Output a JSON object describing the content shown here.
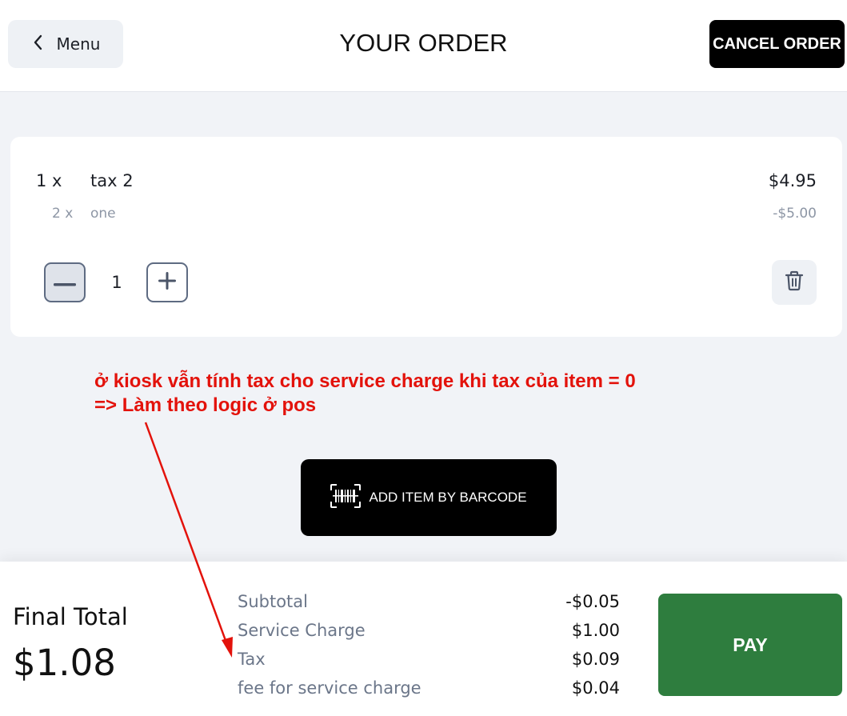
{
  "header": {
    "back_label": "Menu",
    "title": "YOUR ORDER",
    "cancel_label": "CANCEL ORDER"
  },
  "order": {
    "items": [
      {
        "qty": "1 x",
        "name": "tax 2",
        "price": "$4.95",
        "modifier": {
          "qty": "2 x",
          "name": "one",
          "price": "-$5.00"
        },
        "quantity": "1"
      }
    ]
  },
  "annotation": {
    "line1": "ở kiosk vẫn tính tax cho service charge khi tax của item = 0",
    "line2": "=> Làm theo logic ở pos",
    "color": "#e3120b"
  },
  "barcode": {
    "label": "ADD ITEM BY BARCODE"
  },
  "footer": {
    "final_label": "Final Total",
    "final_amount": "$1.08",
    "summary": [
      {
        "label": "Subtotal",
        "value": "-$0.05"
      },
      {
        "label": "Service Charge",
        "value": "$1.00"
      },
      {
        "label": "Tax",
        "value": "$0.09"
      },
      {
        "label": "fee for service charge",
        "value": "$0.04"
      }
    ],
    "pay_label": "PAY"
  },
  "colors": {
    "pay_green": "#2e7d3e",
    "background": "#f1f3f7",
    "muted_text": "#8d96a5"
  }
}
